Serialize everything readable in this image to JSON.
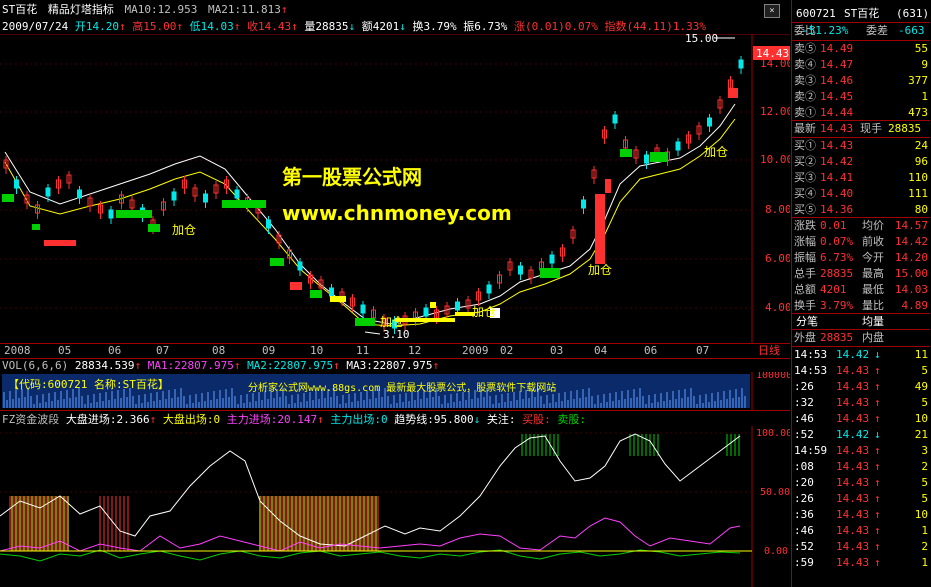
{
  "colors": {
    "bg": "#000000",
    "up": "#ff3030",
    "down": "#00e8e8",
    "frame": "#a00000",
    "yellow": "#ffff00",
    "white": "#ffffff",
    "magenta": "#ff40ff",
    "green": "#00d000"
  },
  "header": {
    "stock": "ST百花",
    "indicator_name": "精品灯塔指标",
    "ma10": "MA10:12.953",
    "ma21": "MA21:11.813",
    "date": "2009/07/24",
    "open": "开14.20",
    "high": "高15.00",
    "low": "低14.03",
    "close": "收14.43",
    "volume": "量28835",
    "amount": "额4201",
    "turnover": "换3.79%",
    "amplitude": "振6.73%",
    "change": "涨(0.01)0.07%",
    "index": "指数(44.11)1.33%"
  },
  "chart": {
    "high_label": "15.00",
    "low_label": "3.10",
    "current_price_tag": "14.43",
    "price_ticks": [
      "14.00",
      "12.00",
      "10.00",
      "8.00",
      "6.00",
      "4.00"
    ],
    "add_position_label": "加仓",
    "watermark_title": "第一股票公式网",
    "watermark_url": "www.chnmoney.com",
    "date_axis": [
      "2008",
      "05",
      "06",
      "07",
      "08",
      "09",
      "10",
      "11",
      "12",
      "2009",
      "02",
      "03",
      "04",
      "06",
      "07"
    ],
    "period_label": "日线"
  },
  "volume_panel": {
    "title": "VOL(6,6,6)",
    "vol": "28834.539",
    "ma1": "MA1:22807.975",
    "ma2": "MA2:22807.975",
    "ma3": "MA3:22807.975",
    "banner_code": "【代码:600721  名称:ST百花】",
    "banner_site": "分析家公式网www.88gs.com 最新最大股票公式，股票软件下载网站",
    "tick": "100000"
  },
  "fz_panel": {
    "title": "FZ资金波段",
    "big_in": "大盘进场:2.366",
    "big_out": "大盘出场:0",
    "main_in": "主力进场:20.147",
    "main_out": "主力出场:0",
    "trend": "趋势线:95.800",
    "watch": "关注:",
    "buy": "买股:",
    "sell": "卖股:",
    "ticks": [
      "100.00",
      "50.00",
      "0.00"
    ]
  },
  "quote": {
    "code": "600721",
    "name": "ST百花",
    "count": "(631)",
    "weibi_label": "委比",
    "weibi": "-51.23%",
    "weicha_label": "委差",
    "weicha": "-663",
    "asks": [
      {
        "label": "卖⑤",
        "price": "14.49",
        "vol": "55"
      },
      {
        "label": "卖④",
        "price": "14.47",
        "vol": "9"
      },
      {
        "label": "卖③",
        "price": "14.46",
        "vol": "377"
      },
      {
        "label": "卖②",
        "price": "14.45",
        "vol": "1"
      },
      {
        "label": "卖①",
        "price": "14.44",
        "vol": "473"
      }
    ],
    "last_label": "最新",
    "last": "14.43",
    "xs_label": "现手",
    "xs": "28835",
    "bids": [
      {
        "label": "买①",
        "price": "14.43",
        "vol": "24"
      },
      {
        "label": "买②",
        "price": "14.42",
        "vol": "96"
      },
      {
        "label": "买③",
        "price": "14.41",
        "vol": "110"
      },
      {
        "label": "买④",
        "price": "14.40",
        "vol": "111"
      },
      {
        "label": "买⑤",
        "price": "14.36",
        "vol": "80"
      }
    ],
    "stats": [
      {
        "l1": "涨跌",
        "v1": "0.01",
        "l2": "均价",
        "v2": "14.57"
      },
      {
        "l1": "涨幅",
        "v1": "0.07%",
        "l2": "前收",
        "v2": "14.42"
      },
      {
        "l1": "振幅",
        "v1": "6.73%",
        "l2": "今开",
        "v2": "14.20"
      },
      {
        "l1": "总手",
        "v1": "28835",
        "l2": "最高",
        "v2": "15.00"
      },
      {
        "l1": "总额",
        "v1": "4201",
        "l2": "最低",
        "v2": "14.03"
      },
      {
        "l1": "换手",
        "v1": "3.79%",
        "l2": "量比",
        "v2": "4.89"
      }
    ],
    "tab_fenbi": "分笔",
    "tab_juliang": "均量",
    "waipan_label": "外盘",
    "waipan": "28835",
    "neipan_label": "内盘",
    "ticks": [
      {
        "t": "14:53",
        "p": "14.42",
        "d": "↓",
        "v": "11"
      },
      {
        "t": "14:53",
        "p": "14.43",
        "d": "↑",
        "v": "5"
      },
      {
        "t": ":26",
        "p": "14.43",
        "d": "↑",
        "v": "49"
      },
      {
        "t": ":32",
        "p": "14.43",
        "d": "↑",
        "v": "5"
      },
      {
        "t": ":46",
        "p": "14.43",
        "d": "↑",
        "v": "10"
      },
      {
        "t": ":52",
        "p": "14.42",
        "d": "↓",
        "v": "21"
      },
      {
        "t": "14:59",
        "p": "14.43",
        "d": "↑",
        "v": "3"
      },
      {
        "t": ":08",
        "p": "14.43",
        "d": "↑",
        "v": "2"
      },
      {
        "t": ":20",
        "p": "14.43",
        "d": "↑",
        "v": "5"
      },
      {
        "t": ":26",
        "p": "14.43",
        "d": "↑",
        "v": "5"
      },
      {
        "t": ":36",
        "p": "14.43",
        "d": "↑",
        "v": "10"
      },
      {
        "t": ":46",
        "p": "14.43",
        "d": "↑",
        "v": "1"
      },
      {
        "t": ":52",
        "p": "14.43",
        "d": "↑",
        "v": "2"
      },
      {
        "t": ":59",
        "p": "14.43",
        "d": "↑",
        "v": "1"
      }
    ]
  }
}
